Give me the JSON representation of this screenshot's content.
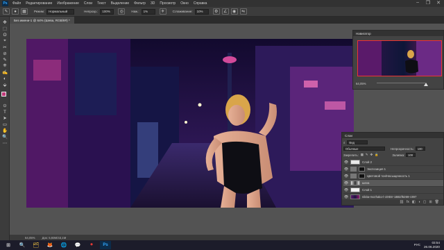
{
  "menubar": {
    "logo": "Ps",
    "items": [
      "Файл",
      "Редактирование",
      "Изображение",
      "Слои",
      "Текст",
      "Выделение",
      "Фильтр",
      "3D",
      "Просмотр",
      "Окно",
      "Справка"
    ],
    "window_controls": [
      "–",
      "❐",
      "✕"
    ]
  },
  "options": {
    "mode_label": "Режим:",
    "mode_value": "Нормальный",
    "opacity_label": "Непрозр.:",
    "opacity_value": "100%",
    "flow_label": "Наж.:",
    "flow_value": "1%",
    "smoothing_label": "Сглаживание:",
    "smoothing_value": "10%"
  },
  "document": {
    "tab_title": "Без имени-1 @ 64% (Шева, RGB/8#) *"
  },
  "toolbar": {
    "tools": [
      "✥",
      "⬚",
      "ʘ",
      "⌖",
      "✂",
      "⊘",
      "✎",
      "⎈",
      "✍",
      "◐",
      "⬙",
      "⊙",
      "T",
      "➤",
      "▭",
      "✋",
      "🔍",
      "⋯"
    ],
    "foreground_color": "#c03a7a",
    "background_color": "#ffffff"
  },
  "navigator": {
    "title": "Навигатор",
    "zoom": "64,05%"
  },
  "layers": {
    "title": "Слои",
    "filter_label": "Вид",
    "blend_mode": "Обычные",
    "opacity_label": "Непрозрачность:",
    "opacity_value": "100",
    "lock_label": "Закрепить:",
    "fill_label": "Заливка:",
    "fill_value": "100",
    "items": [
      {
        "name": "Слой 2",
        "selected": false,
        "mask": false
      },
      {
        "name": "Экспозиция 1",
        "selected": false,
        "mask": true
      },
      {
        "name": "Цветовой тон/Насыщенность 1",
        "selected": false,
        "mask": true
      },
      {
        "name": "шеva",
        "selected": true,
        "mask": false
      },
      {
        "name": "Слой 1",
        "selected": false,
        "mask": false
      },
      {
        "name": "nikita-mozhako-l-ctXBrr-1BB2f6269-r.897",
        "selected": false,
        "mask": false
      }
    ],
    "footer_icons": [
      "⛓",
      "fx",
      "◧",
      "◑",
      "▢",
      "⊞",
      "🗑"
    ]
  },
  "status": {
    "zoom": "64,05%",
    "doc_size": "Док: 5,93M/43,1M"
  },
  "taskbar": {
    "apps": [
      "⊞",
      "🔍",
      "🗂",
      "🦊",
      "🌐",
      "💬",
      "⏺",
      "Ps"
    ],
    "language": "РУС",
    "time": "03:54",
    "date": "26.06.2020"
  }
}
